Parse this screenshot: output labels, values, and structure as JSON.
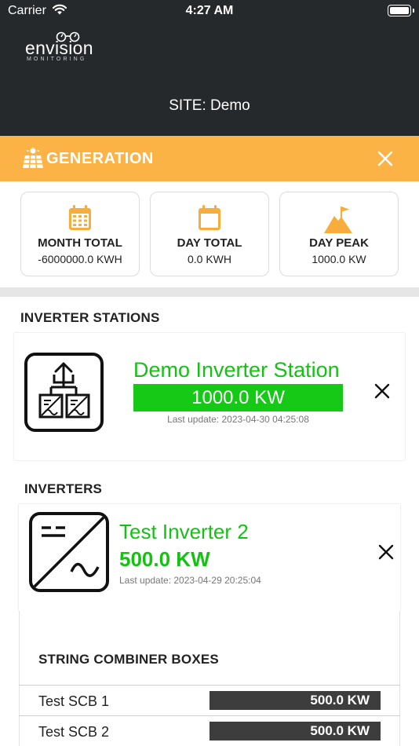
{
  "status_bar": {
    "carrier": "Carrier",
    "time": "4:27 AM"
  },
  "header": {
    "logo_word": "envision",
    "logo_sub": "MONITORING",
    "site_title": "SITE: Demo"
  },
  "generation": {
    "title": "GENERATION"
  },
  "stats": [
    {
      "label": "MONTH TOTAL",
      "value": "-6000000.0 KWH",
      "icon": "calendar-grid-icon"
    },
    {
      "label": "DAY TOTAL",
      "value": "0.0 KWH",
      "icon": "calendar-icon"
    },
    {
      "label": "DAY PEAK",
      "value": "1000.0 KW",
      "icon": "mountain-flag-icon"
    }
  ],
  "inverter_stations": {
    "heading": "INVERTER STATIONS",
    "station": {
      "name": "Demo Inverter Station",
      "power": "1000.0 KW",
      "last_update": "Last update: 2023-04-30 04:25:08"
    }
  },
  "inverters": {
    "heading": "INVERTERS",
    "inverter": {
      "name": "Test Inverter 2",
      "power": "500.0 KW",
      "last_update": "Last update: 2023-04-29 20:25:04"
    }
  },
  "scb": {
    "heading": "STRING COMBINER BOXES",
    "rows": [
      {
        "name": "Test SCB 1",
        "power": "500.0 KW"
      },
      {
        "name": "Test SCB 2",
        "power": "500.0 KW"
      }
    ]
  },
  "colors": {
    "header_bg": "#26292c",
    "accent_orange": "#fcb346",
    "value_green": "#13c213",
    "bar_dark": "#3d3d3d"
  }
}
